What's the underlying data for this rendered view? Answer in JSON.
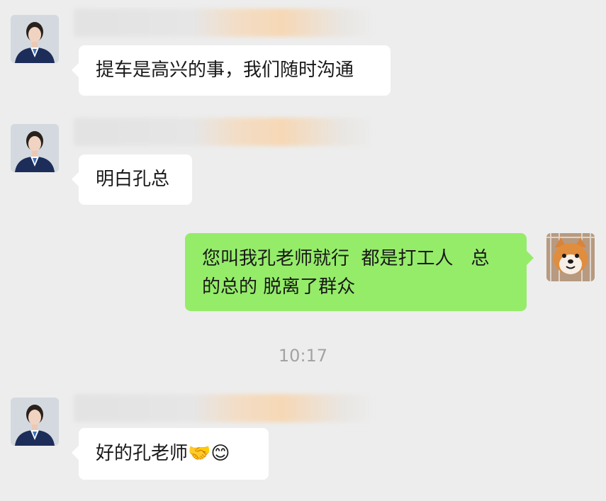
{
  "messages": [
    {
      "side": "left",
      "text": "提车是高兴的事，我们随时沟通"
    },
    {
      "side": "left",
      "text": "明白孔总"
    },
    {
      "side": "right",
      "line1": "您叫我孔老师就行  都是打工人   总",
      "line2": "的总的 脱离了群众"
    },
    {
      "side": "left",
      "text": "好的孔老师🤝😊"
    }
  ],
  "timestamp": "10:17",
  "icons": {
    "agent_avatar": "agent-avatar-icon",
    "self_avatar": "shiba-dog-avatar-icon"
  },
  "colors": {
    "background": "#ededed",
    "incoming_bubble": "#ffffff",
    "outgoing_bubble": "#95ec69",
    "timestamp": "#a3a3a3"
  }
}
